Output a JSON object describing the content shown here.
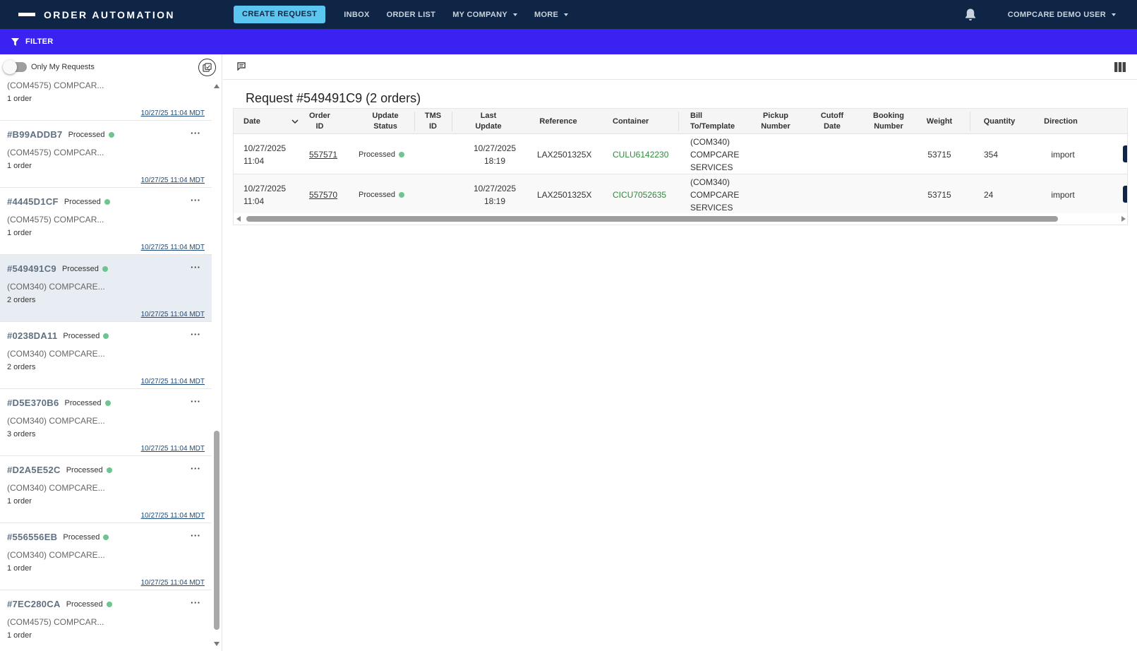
{
  "nav": {
    "brand": "ORDER AUTOMATION",
    "create_request": "CREATE REQUEST",
    "inbox": "INBOX",
    "order_list": "ORDER LIST",
    "my_company": "MY COMPANY",
    "more": "MORE",
    "user": "COMPCARE DEMO USER"
  },
  "filter": {
    "label": "FILTER"
  },
  "left": {
    "toggle_label": "Only My Requests",
    "items": [
      {
        "id": "",
        "status": "",
        "company": "(COM4575) COMPCAR...",
        "count": "1 order",
        "time": "10/27/25 11:04 MDT"
      },
      {
        "id": "#B99ADDB7",
        "status": "Processed",
        "company": "(COM4575) COMPCAR...",
        "count": "1 order",
        "time": "10/27/25 11:04 MDT"
      },
      {
        "id": "#4445D1CF",
        "status": "Processed",
        "company": "(COM4575) COMPCAR...",
        "count": "1 order",
        "time": "10/27/25 11:04 MDT"
      },
      {
        "id": "#549491C9",
        "status": "Processed",
        "company": "(COM340) COMPCARE...",
        "count": "2 orders",
        "time": "10/27/25 11:04 MDT"
      },
      {
        "id": "#0238DA11",
        "status": "Processed",
        "company": "(COM340) COMPCARE...",
        "count": "2 orders",
        "time": "10/27/25 11:04 MDT"
      },
      {
        "id": "#D5E370B6",
        "status": "Processed",
        "company": "(COM340) COMPCARE...",
        "count": "3 orders",
        "time": "10/27/25 11:04 MDT"
      },
      {
        "id": "#D2A5E52C",
        "status": "Processed",
        "company": "(COM340) COMPCARE...",
        "count": "1 order",
        "time": "10/27/25 11:04 MDT"
      },
      {
        "id": "#556556EB",
        "status": "Processed",
        "company": "(COM340) COMPCARE...",
        "count": "1 order",
        "time": "10/27/25 11:04 MDT"
      },
      {
        "id": "#7EC280CA",
        "status": "Processed",
        "company": "(COM4575) COMPCAR...",
        "count": "1 order",
        "time": ""
      }
    ]
  },
  "request": {
    "title": "Request #549491C9 (2 orders)",
    "columns": {
      "date": "Date",
      "order_id_1": "Order",
      "order_id_2": "ID",
      "update_status_1": "Update",
      "update_status_2": "Status",
      "tms_id_1": "TMS",
      "tms_id_2": "ID",
      "last_update_1": "Last",
      "last_update_2": "Update",
      "reference": "Reference",
      "container": "Container",
      "bill_1": "Bill",
      "bill_2": "To/Template",
      "pickup_1": "Pickup",
      "pickup_2": "Number",
      "cutoff_1": "Cutoff",
      "cutoff_2": "Date",
      "booking_1": "Booking",
      "booking_2": "Number",
      "weight": "Weight",
      "quantity": "Quantity",
      "direction": "Direction"
    },
    "rows": [
      {
        "date_1": "10/27/2025",
        "date_2": "11:04",
        "order_id": "557571",
        "status": "Processed",
        "last_update_1": "10/27/2025",
        "last_update_2": "18:19",
        "reference": "LAX2501325X",
        "container": "CULU6142230",
        "bill_1": "(COM340)",
        "bill_2": "COMPCARE",
        "bill_3": "SERVICES",
        "weight": "53715",
        "quantity": "354",
        "direction": "import"
      },
      {
        "date_1": "10/27/2025",
        "date_2": "11:04",
        "order_id": "557570",
        "status": "Processed",
        "last_update_1": "10/27/2025",
        "last_update_2": "18:19",
        "reference": "LAX2501325X",
        "container": "CICU7052635",
        "bill_1": "(COM340)",
        "bill_2": "COMPCARE",
        "bill_3": "SERVICES",
        "weight": "53715",
        "quantity": "24",
        "direction": "import"
      }
    ]
  },
  "colors": {
    "nav_bg": "#0f2546",
    "filter_bg": "#3a22f2",
    "accent_button": "#5bc6f0",
    "status_dot": "#6fc58f",
    "container_text": "#2e8b3a"
  },
  "icons": [
    "bell-icon",
    "filter-icon",
    "compose-icon",
    "message-icon",
    "columns-icon",
    "chevron-down-icon",
    "more-icon"
  ]
}
